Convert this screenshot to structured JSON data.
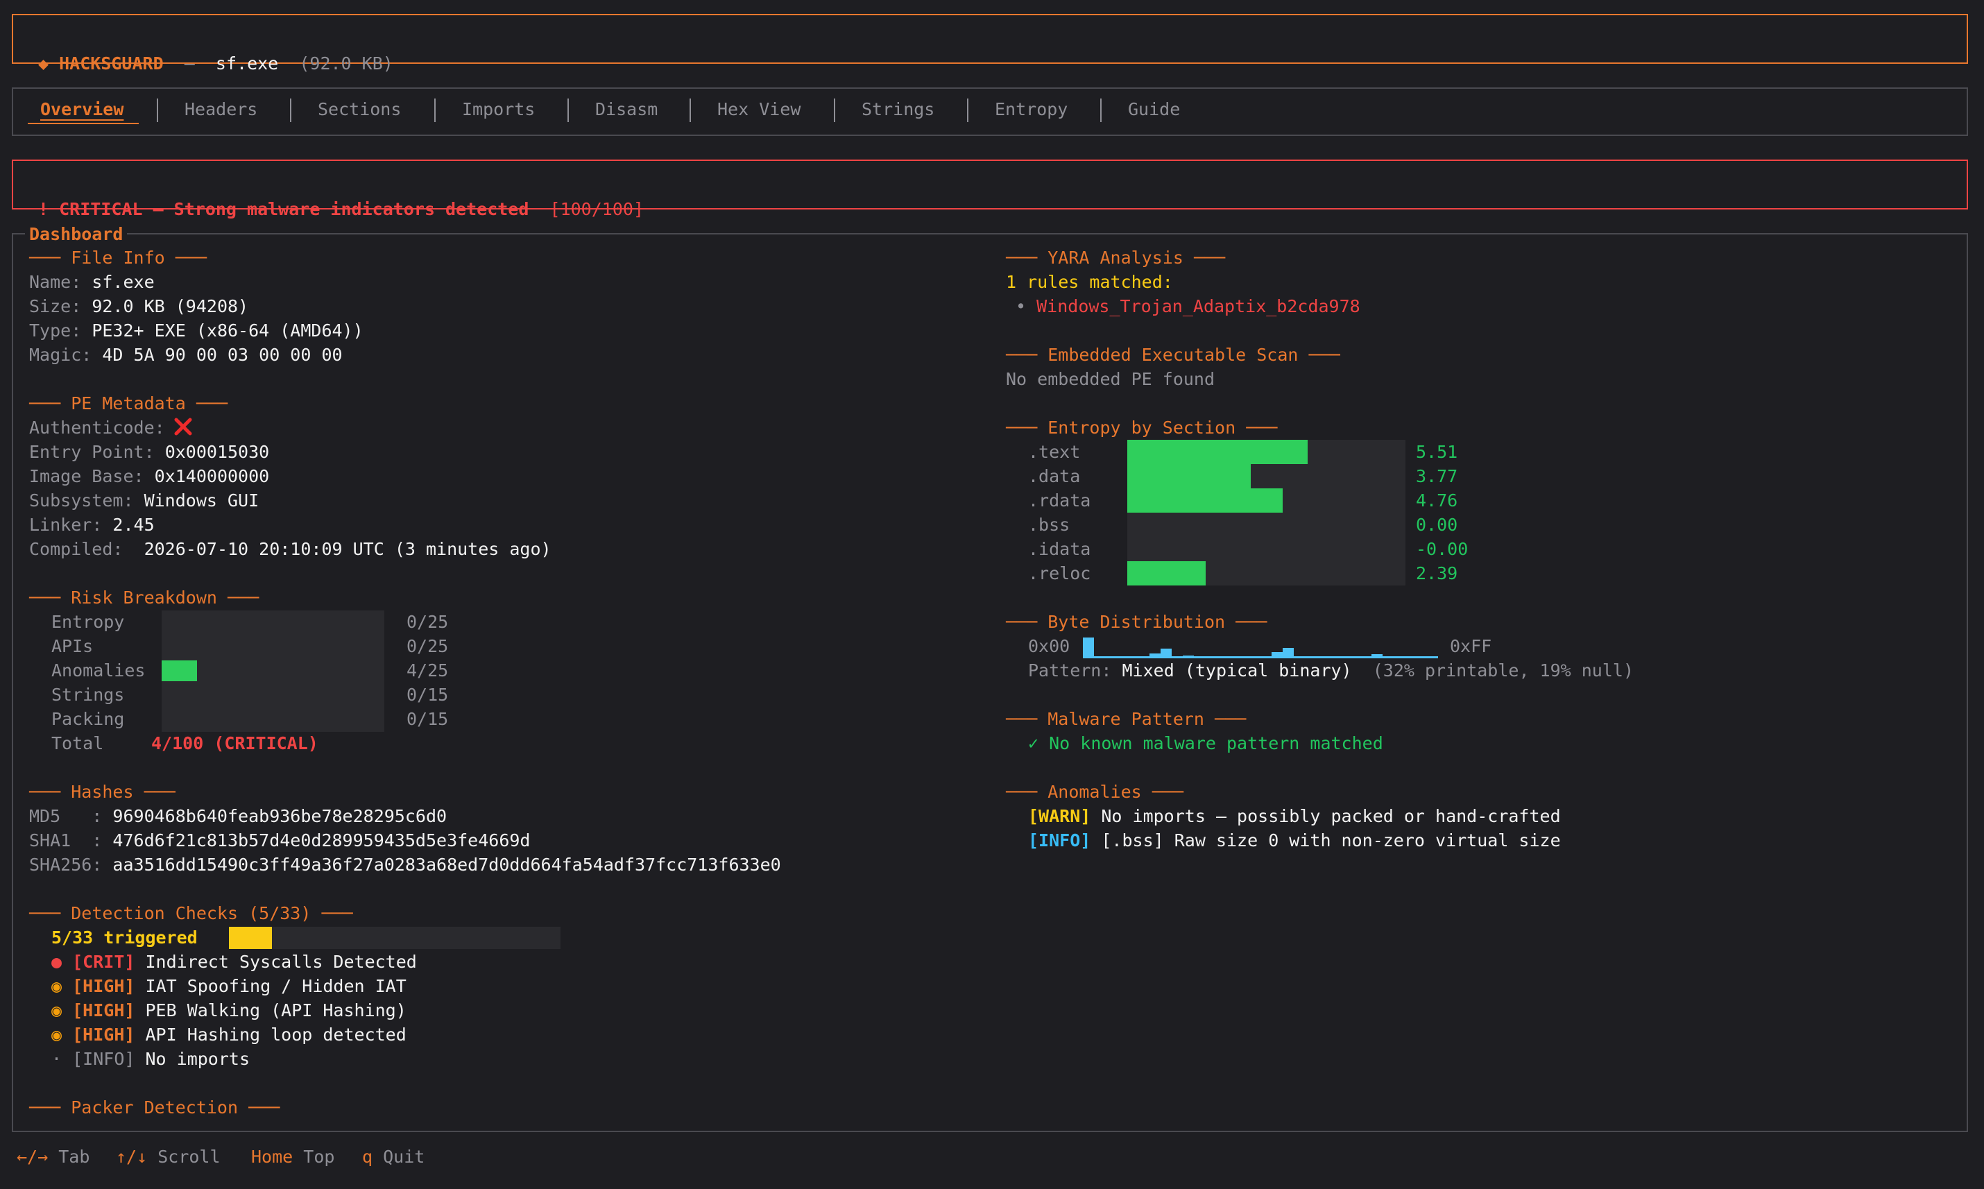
{
  "header": {
    "diamond": "◆",
    "app_name": "HACKSGUARD",
    "sep": "—",
    "file_name": "sf.exe",
    "file_size": "(92.0 KB)"
  },
  "tabs": [
    "Overview",
    "Headers",
    "Sections",
    "Imports",
    "Disasm",
    "Hex View",
    "Strings",
    "Entropy",
    "Guide"
  ],
  "alert": {
    "text": "! CRITICAL — Strong malware indicators detected",
    "score": "[100/100]"
  },
  "dashboard_title": "Dashboard",
  "file_info": {
    "title": "File Info",
    "rows": [
      {
        "label": "Name:",
        "value": "sf.exe"
      },
      {
        "label": "Size:",
        "value": "92.0 KB (94208)"
      },
      {
        "label": "Type:",
        "value": "PE32+ EXE (x86-64 (AMD64))"
      },
      {
        "label": "Magic:",
        "value": "4D 5A 90 00 03 00 00 00"
      }
    ]
  },
  "pe_metadata": {
    "title": "PE Metadata",
    "authenticode_label": "Authenticode:",
    "authenticode_icon": "cross-mark-icon",
    "rows": [
      {
        "label": "Entry Point:",
        "value": "0x00015030"
      },
      {
        "label": "Image Base:",
        "value": "0x140000000"
      },
      {
        "label": "Subsystem:",
        "value": "Windows GUI"
      },
      {
        "label": "Linker:",
        "value": "2.45"
      },
      {
        "label": "Compiled:",
        "value": " 2026-07-10 20:10:09 UTC (3 minutes ago)"
      }
    ]
  },
  "risk": {
    "title": "Risk Breakdown",
    "rows": [
      {
        "label": "Entropy",
        "score": "0/25",
        "fraction": 0
      },
      {
        "label": "APIs",
        "score": "0/25",
        "fraction": 0
      },
      {
        "label": "Anomalies",
        "score": "4/25",
        "fraction": 0.16
      },
      {
        "label": "Strings",
        "score": "0/15",
        "fraction": 0
      },
      {
        "label": "Packing",
        "score": "0/15",
        "fraction": 0
      }
    ],
    "total_label": "Total",
    "total_value": "4/100 (CRITICAL)"
  },
  "hashes": {
    "title": "Hashes",
    "rows": [
      {
        "label": "MD5   :",
        "value": "9690468b640feab936be78e28295c6d0"
      },
      {
        "label": "SHA1  :",
        "value": "476d6f21c813b57d4e0d289959435d5e3fe4669d"
      },
      {
        "label": "SHA256:",
        "value": "aa3516dd15490c3ff49a36f27a0283a68ed7d0dd664fa54adf37fcc713f633e0"
      }
    ]
  },
  "detection": {
    "title": "Detection Checks (5/33)",
    "triggered": "5/33 triggered",
    "fraction": 0.1515,
    "items": [
      {
        "bullet": "●",
        "tag": "[CRIT]",
        "text": "Indirect Syscalls Detected",
        "level": "crit"
      },
      {
        "bullet": "◉",
        "tag": "[HIGH]",
        "text": "IAT Spoofing / Hidden IAT",
        "level": "high"
      },
      {
        "bullet": "◉",
        "tag": "[HIGH]",
        "text": "PEB Walking (API Hashing)",
        "level": "high"
      },
      {
        "bullet": "◉",
        "tag": "[HIGH]",
        "text": "API Hashing loop detected",
        "level": "high"
      },
      {
        "bullet": "·",
        "tag": "[INFO]",
        "text": "No imports",
        "level": "info"
      }
    ]
  },
  "packer": {
    "title": "Packer Detection"
  },
  "yara": {
    "title": "YARA Analysis",
    "matched": "1 rules matched:",
    "bullet": "•",
    "rules": [
      "Windows_Trojan_Adaptix_b2cda978"
    ]
  },
  "embedded": {
    "title": "Embedded Executable Scan",
    "text": "No embedded PE found"
  },
  "entropy": {
    "title": "Entropy by Section",
    "max": 8,
    "sections": [
      {
        "name": ".text",
        "value": "5.51",
        "num": 5.51
      },
      {
        "name": ".data",
        "value": "3.77",
        "num": 3.77
      },
      {
        "name": ".rdata",
        "value": "4.76",
        "num": 4.76
      },
      {
        "name": ".bss",
        "value": "0.00",
        "num": 0
      },
      {
        "name": ".idata",
        "value": "-0.00",
        "num": 0
      },
      {
        "name": ".reloc",
        "value": "2.39",
        "num": 2.39
      }
    ]
  },
  "bytes": {
    "title": "Byte Distribution",
    "start": "0x00",
    "end": "0xFF",
    "histogram": [
      1.0,
      0.08,
      0.05,
      0.04,
      0.06,
      0.08,
      0.22,
      0.45,
      0.1,
      0.12,
      0.05,
      0.04,
      0.08,
      0.05,
      0.04,
      0.05,
      0.1,
      0.3,
      0.5,
      0.1,
      0.06,
      0.04,
      0.05,
      0.04,
      0.04,
      0.06,
      0.2,
      0.06,
      0.04,
      0.05,
      0.04,
      0.06
    ],
    "pattern_label": "Pattern:",
    "pattern_value": "Mixed (typical binary)",
    "pattern_note": "(32% printable, 19% null)"
  },
  "malware": {
    "title": "Malware Pattern",
    "check": "✓",
    "text": "No known malware pattern matched"
  },
  "anomalies": {
    "title": "Anomalies",
    "items": [
      {
        "tag": "[WARN]",
        "text": "No imports — possibly packed or hand-crafted",
        "level": "warn"
      },
      {
        "tag": "[INFO]",
        "text": "[.bss] Raw size 0 with non-zero virtual size",
        "level": "info"
      }
    ]
  },
  "footer": [
    {
      "key": "←/→",
      "label": "Tab"
    },
    {
      "key": "↑/↓",
      "label": "Scroll"
    },
    {
      "key": "Home",
      "label": "Top"
    },
    {
      "key": "q",
      "label": "Quit"
    }
  ]
}
